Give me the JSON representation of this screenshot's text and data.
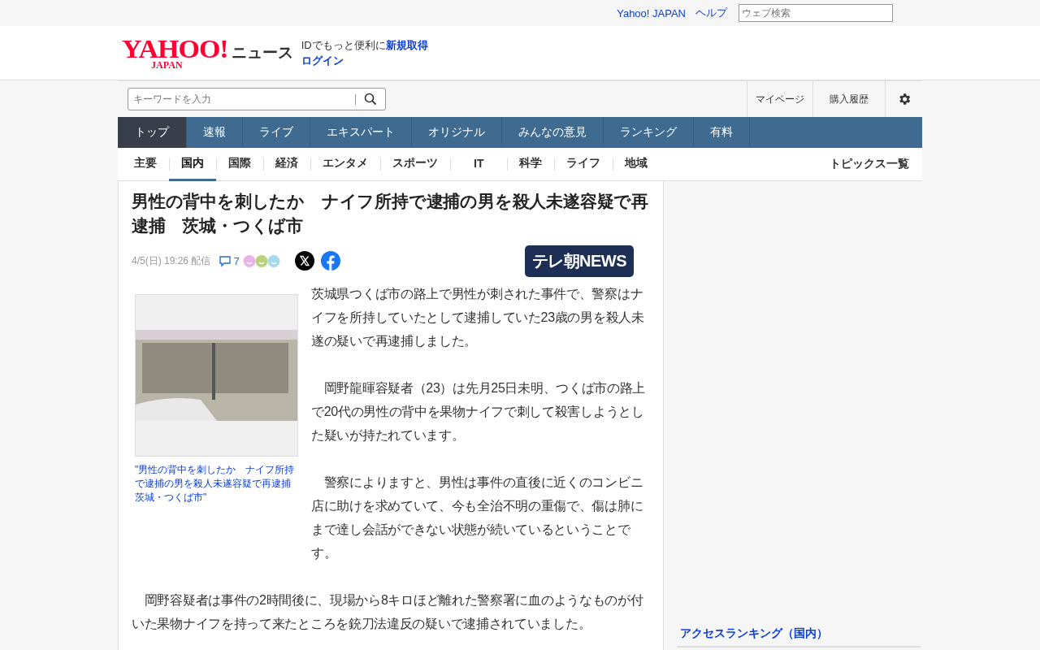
{
  "top_bar": {
    "links": [
      "Yahoo! JAPAN",
      "ヘルプ"
    ],
    "search": {
      "placeholder": "ウェブ検索"
    }
  },
  "brand": {
    "logo": "YAHOO!",
    "logo_sub": "JAPAN",
    "service": "ニュース"
  },
  "account": {
    "prompt": "IDでもっと便利に",
    "signup": "新規取得",
    "login": "ログイン"
  },
  "search": {
    "placeholder": "キーワードを入力"
  },
  "utility_links": [
    "マイページ",
    "購入履歴"
  ],
  "nav_tabs": [
    {
      "label": "トップ",
      "selected": true
    },
    {
      "label": "速報",
      "selected": false
    },
    {
      "label": "ライブ",
      "selected": false
    },
    {
      "label": "エキスパート",
      "selected": false
    },
    {
      "label": "オリジナル",
      "selected": false
    },
    {
      "label": "みんなの意見",
      "selected": false
    },
    {
      "label": "ランキング",
      "selected": false
    },
    {
      "label": "有料",
      "selected": false
    }
  ],
  "categories": [
    {
      "label": "主要",
      "selected": false
    },
    {
      "label": "国内",
      "selected": true
    },
    {
      "label": "国際",
      "selected": false
    },
    {
      "label": "経済",
      "selected": false
    },
    {
      "label": "エンタメ",
      "selected": false
    },
    {
      "label": "スポーツ",
      "selected": false
    },
    {
      "label": "IT",
      "selected": false
    },
    {
      "label": "科学",
      "selected": false
    },
    {
      "label": "ライフ",
      "selected": false
    },
    {
      "label": "地域",
      "selected": false
    }
  ],
  "topics_link": "トピックス一覧",
  "article": {
    "title": "男性の背中を刺したか　ナイフ所持で逮捕の男を殺人未遂容疑で再逮捕　茨城・つくば市",
    "date": "4/5(日) 19:26 配信",
    "comment_count": "7",
    "source": "テレ朝NEWS",
    "photo_caption": "\"男性の背中を刺したか　ナイフ所持で逮捕の男を殺人未遂容疑で再逮捕茨城・つくば市\"",
    "paragraphs": [
      "茨城県つくば市の路上で男性が刺された事件で、警察はナイフを所持していたとして逮捕していた23歳の男を殺人未遂の疑いで再逮捕しました。",
      "　岡野龍暉容疑者（23）は先月25日未明、つくば市の路上で20代の男性の背中を果物ナイフで刺して殺害しようとした疑いが持たれています。",
      "　警察によりますと、男性は事件の直後に近くのコンビニ店に助けを求めていて、今も全治不明の重傷で、傷は肺にまで達し会話ができない状態が続いているということです。",
      "　岡野容疑者は事件の2時間後に、現場から8キロほど離れた警察署に血のようなものが付いた果物ナイフを持って来たところを銃刀法違反の疑いで逮捕されていました。"
    ]
  },
  "sidebar": {
    "heading": "アクセスランキング（国内）"
  }
}
